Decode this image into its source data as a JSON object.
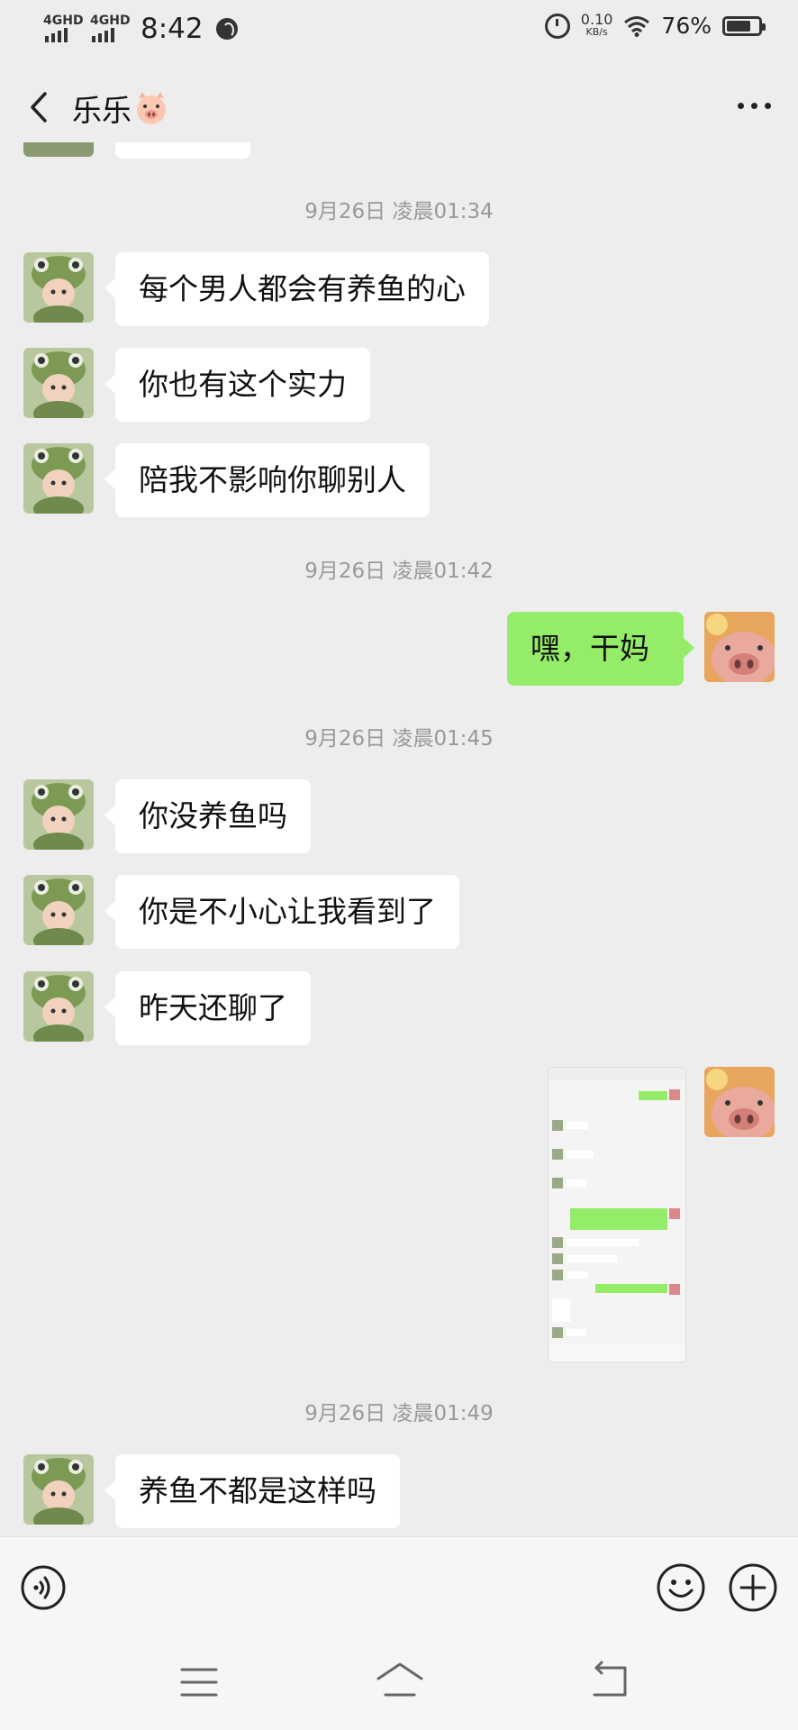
{
  "status_bar": {
    "signal1": "4GHD",
    "signal2": "4GHD",
    "time": "8:42",
    "net_speed_value": "0.10",
    "net_speed_unit": "KB/s",
    "battery": "76%",
    "battery_level": 0.76
  },
  "header": {
    "contact_name": "乐乐",
    "name_emoji": "pig-face-icon",
    "back_icon": "chevron-left-icon",
    "more_icon": "more-dots-icon"
  },
  "messages": {
    "ts1": "9月26日 凌晨01:34",
    "m1": "每个男人都会有养鱼的心",
    "m2": "你也有这个实力",
    "m3": "陪我不影响你聊别人",
    "ts2": "9月26日 凌晨01:42",
    "m4": "嘿，干妈",
    "ts3": "9月26日 凌晨01:45",
    "m5": "你没养鱼吗",
    "m6": "你是不小心让我看到了",
    "m7": "昨天还聊了",
    "ts4": "9月26日 凌晨01:49",
    "m8": "养鱼不都是这样吗"
  },
  "input_bar": {
    "voice_icon": "voice-icon",
    "emoji_icon": "emoji-icon",
    "plus_icon": "plus-icon",
    "placeholder": ""
  },
  "nav_bar": {
    "icons": [
      "menu-icon",
      "home-icon",
      "back-icon"
    ]
  },
  "colors": {
    "background": "#ededed",
    "bubble_right": "#95ec69",
    "bubble_left": "#ffffff",
    "timestamp": "#999999"
  }
}
